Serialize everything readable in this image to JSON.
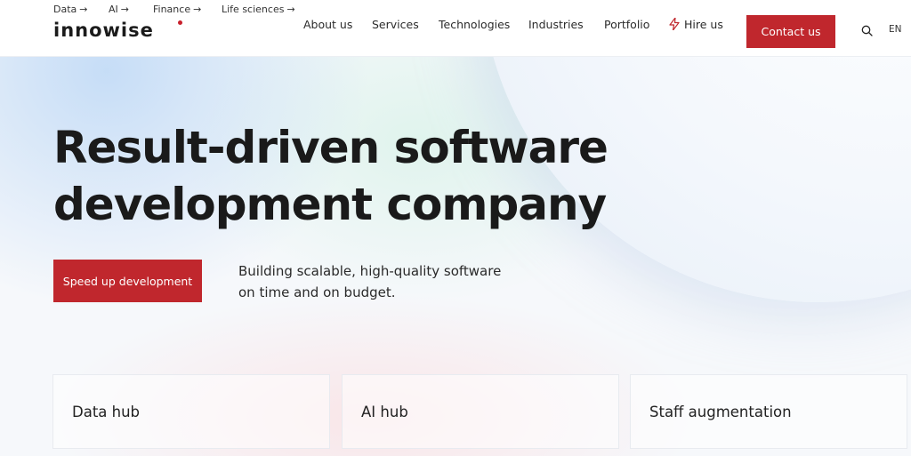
{
  "topbar": {
    "hub_links": [
      {
        "label": "Data",
        "arrow": "→"
      },
      {
        "label": "AI",
        "arrow": "→"
      },
      {
        "label": "Finance",
        "arrow": "→"
      },
      {
        "label": "Life sciences",
        "arrow": "→"
      }
    ]
  },
  "brand": {
    "logo_text": "innowise",
    "accent_color": "#c0272d"
  },
  "nav": {
    "items": [
      "About us",
      "Services",
      "Technologies",
      "Industries",
      "Portfolio"
    ],
    "hire_label": "Hire us",
    "contact_label": "Contact us",
    "search_icon": "search-icon",
    "language": "EN"
  },
  "hero": {
    "title_line1": "Result-driven software",
    "title_line2": "development company",
    "cta_label": "Speed up development",
    "subtitle_line1": "Building scalable, high-quality software",
    "subtitle_line2": "on time and on budget."
  },
  "cards": [
    {
      "label": "Data hub"
    },
    {
      "label": "AI hub"
    },
    {
      "label": "Staff augmentation"
    }
  ]
}
